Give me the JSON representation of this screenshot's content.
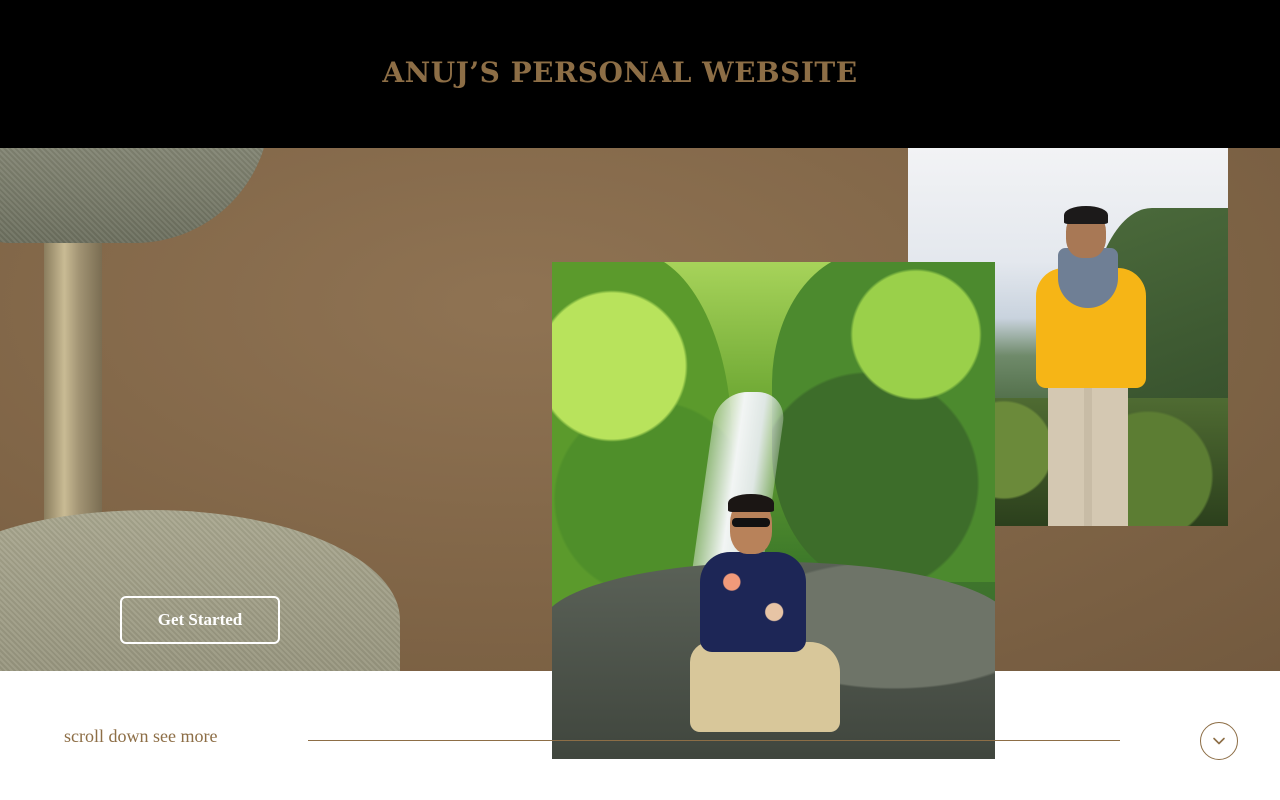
{
  "header": {
    "site_title": "ANUJ’S PERSONAL WEBSITE"
  },
  "hero": {
    "cta_label": "Get Started",
    "images": [
      {
        "name": "man-by-waterfall-photo"
      },
      {
        "name": "man-in-yellow-sweater-photo"
      }
    ]
  },
  "footer": {
    "scroll_text": "scroll down see more",
    "scroll_icon": "chevron-down-icon"
  },
  "colors": {
    "accent": "#8d6e46",
    "header_bg": "#000000",
    "hero_bg": "#7f6446"
  }
}
